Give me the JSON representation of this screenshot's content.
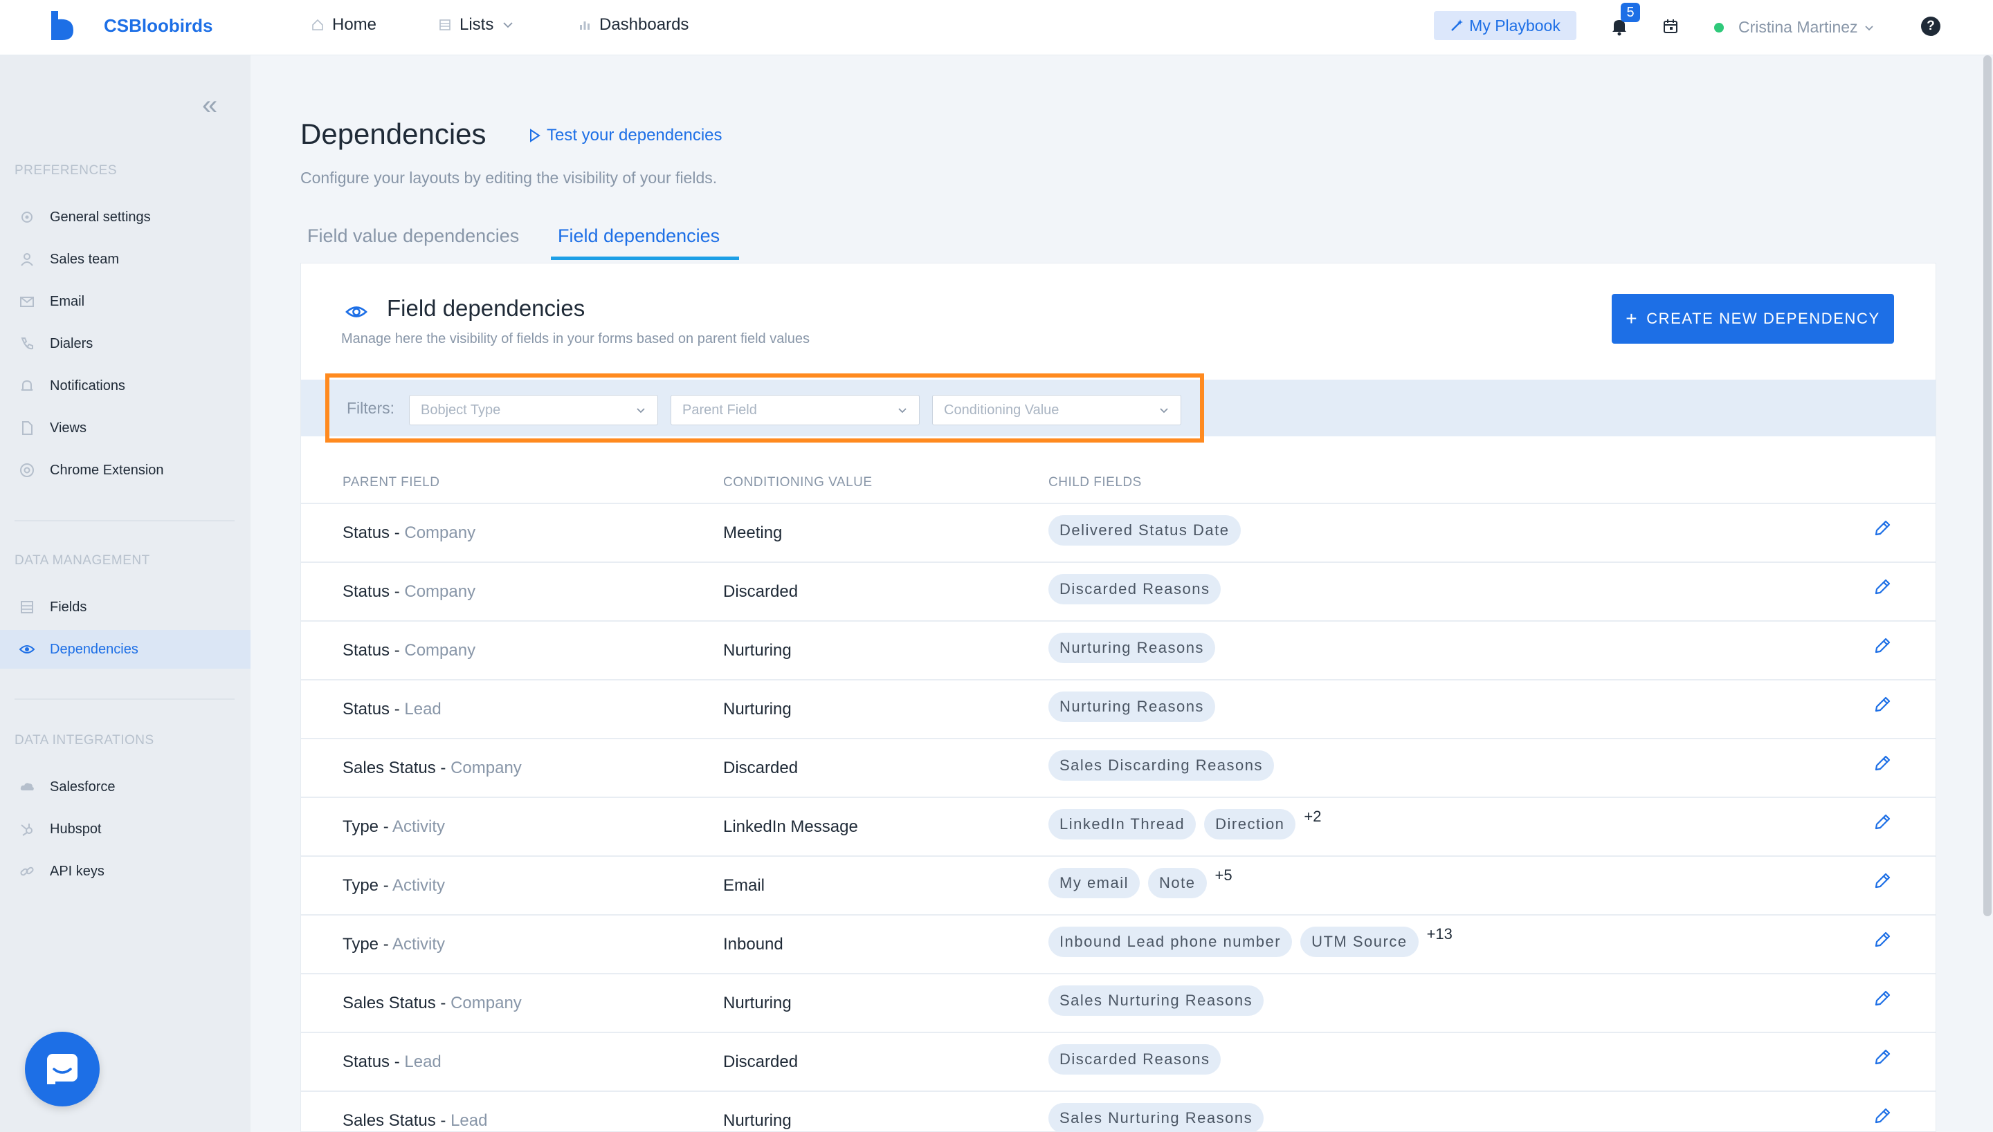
{
  "header": {
    "brand": "CSBloobirds",
    "nav": [
      {
        "label": "Home",
        "icon": "home-icon"
      },
      {
        "label": "Lists",
        "icon": "list-icon"
      },
      {
        "label": "Dashboards",
        "icon": "bar-chart-icon"
      }
    ],
    "playbook_label": "My Playbook",
    "notification_count": "5",
    "user_name": "Cristina Martinez",
    "help_label": "?"
  },
  "sidebar": {
    "sections": [
      {
        "title": "PREFERENCES",
        "items": [
          {
            "label": "General settings",
            "icon": "gear-icon"
          },
          {
            "label": "Sales team",
            "icon": "user-icon"
          },
          {
            "label": "Email",
            "icon": "mail-icon"
          },
          {
            "label": "Dialers",
            "icon": "phone-icon"
          },
          {
            "label": "Notifications",
            "icon": "bell-icon"
          },
          {
            "label": "Views",
            "icon": "file-icon"
          },
          {
            "label": "Chrome Extension",
            "icon": "chrome-icon"
          }
        ]
      },
      {
        "title": "DATA MANAGEMENT",
        "items": [
          {
            "label": "Fields",
            "icon": "list-icon"
          },
          {
            "label": "Dependencies",
            "icon": "eye-icon",
            "active": true
          }
        ]
      },
      {
        "title": "DATA INTEGRATIONS",
        "items": [
          {
            "label": "Salesforce",
            "icon": "cloud-icon"
          },
          {
            "label": "Hubspot",
            "icon": "hubspot-icon"
          },
          {
            "label": "API keys",
            "icon": "link-icon"
          }
        ]
      }
    ]
  },
  "page": {
    "title": "Dependencies",
    "test_link": "Test your dependencies",
    "subtitle": "Configure your layouts by editing the visibility of your fields.",
    "tabs": [
      "Field value dependencies",
      "Field dependencies"
    ],
    "active_tab": "Field dependencies"
  },
  "panel": {
    "title": "Field dependencies",
    "description": "Manage here the visibility of fields in your forms based on parent field values",
    "create_button": "CREATE NEW DEPENDENCY",
    "filters_label": "Filters:",
    "filters": [
      {
        "placeholder": "Bobject Type"
      },
      {
        "placeholder": "Parent Field"
      },
      {
        "placeholder": "Conditioning Value"
      }
    ],
    "columns": [
      "PARENT FIELD",
      "CONDITIONING VALUE",
      "CHILD FIELDS"
    ],
    "rows": [
      {
        "field": "Status",
        "object": "Company",
        "value": "Meeting",
        "children": [
          "Delivered Status Date"
        ],
        "more": ""
      },
      {
        "field": "Status",
        "object": "Company",
        "value": "Discarded",
        "children": [
          "Discarded Reasons"
        ],
        "more": ""
      },
      {
        "field": "Status",
        "object": "Company",
        "value": "Nurturing",
        "children": [
          "Nurturing Reasons"
        ],
        "more": ""
      },
      {
        "field": "Status",
        "object": "Lead",
        "value": "Nurturing",
        "children": [
          "Nurturing Reasons"
        ],
        "more": ""
      },
      {
        "field": "Sales Status",
        "object": "Company",
        "value": "Discarded",
        "children": [
          "Sales Discarding Reasons"
        ],
        "more": ""
      },
      {
        "field": "Type",
        "object": "Activity",
        "value": "LinkedIn Message",
        "children": [
          "LinkedIn Thread",
          "Direction"
        ],
        "more": "+2"
      },
      {
        "field": "Type",
        "object": "Activity",
        "value": "Email",
        "children": [
          "My email",
          "Note"
        ],
        "more": "+5"
      },
      {
        "field": "Type",
        "object": "Activity",
        "value": "Inbound",
        "children": [
          "Inbound Lead phone number",
          "UTM Source"
        ],
        "more": "+13"
      },
      {
        "field": "Sales Status",
        "object": "Company",
        "value": "Nurturing",
        "children": [
          "Sales Nurturing Reasons"
        ],
        "more": ""
      },
      {
        "field": "Status",
        "object": "Lead",
        "value": "Discarded",
        "children": [
          "Discarded Reasons"
        ],
        "more": ""
      },
      {
        "field": "Sales Status",
        "object": "Lead",
        "value": "Nurturing",
        "children": [
          "Sales Nurturing Reasons"
        ],
        "more": ""
      }
    ]
  },
  "colors": {
    "accent": "#1d6fe6",
    "highlight": "#ff8a1f",
    "chip_bg": "#e3ecf7"
  }
}
